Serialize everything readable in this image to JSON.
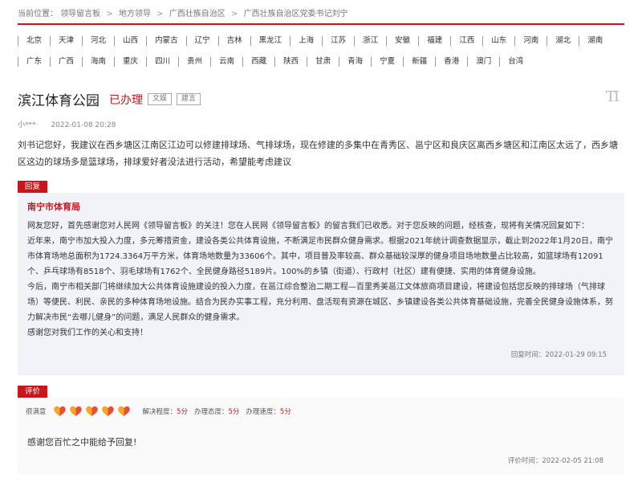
{
  "breadcrumb": {
    "prefix": "当前位置：",
    "items": [
      "领导留言板",
      "地方领导",
      "广西壮族自治区",
      "广西壮族自治区党委书记刘宁"
    ]
  },
  "regions": {
    "row1": [
      "北京",
      "天津",
      "河北",
      "山西",
      "内蒙古",
      "辽宁",
      "吉林",
      "黑龙江",
      "上海",
      "江苏",
      "浙江",
      "安徽",
      "福建",
      "江西",
      "山东",
      "河南",
      "湖北",
      "湖南"
    ],
    "row2": [
      "广东",
      "广西",
      "海南",
      "重庆",
      "四川",
      "贵州",
      "云南",
      "西藏",
      "陕西",
      "甘肃",
      "青海",
      "宁夏",
      "新疆",
      "香港",
      "澳门",
      "台湾"
    ]
  },
  "message": {
    "title": "滨江体育公园",
    "status": "已办理",
    "tags": [
      "文娱",
      "建言"
    ],
    "author": "小***",
    "time": "2022-01-08 20:28",
    "content": "刘书记您好，我建议在西乡塘区江南区江边可以修建排球场、气排球场，现在修建的多集中在青秀区、邕宁区和良庆区离西乡塘区和江南区太远了，西乡塘区这边的球场多是篮球场，排球爱好者没法进行活动，希望能考虑建议"
  },
  "reply": {
    "badge": "回复",
    "org": "南宁市体育局",
    "paragraphs": [
      "网友您好，首先感谢您对人民网《领导留言板》的关注！您在人民网《领导留言板》的留言我们已收悉。对于您反映的问题，经核查，现将有关情况回复如下：",
      "近年来，南宁市加大投入力度，多元筹措资金，建设各类公共体育设施，不断满足市民群众健身需求。根据2021年统计调查数据显示，截止到2022年1月20日，南宁市体育场地总面积为1724.3364万平方米，体育场地数量为33606个。其中，项目普及率较高、群众基础较深厚的健身项目场地数量占比较高，如篮球场有12091个、乒乓球场有8518个、羽毛球场有1762个、全民健身路径5189片。100%的乡镇（街道）、行政村（社区）建有便捷、实用的体育健身设施。",
      "今后，南宁市相关部门将继续加大公共体育设施建设的投入力度，在邕江综合整治二期工程—百里秀美邕江文体旅商项目建设，将建设包括您反映的排球场（气排球场）等便民、利民、亲民的多种体育场地设施。结合为民办实事工程，充分利用、盘活现有资源在城区、乡镇建设各类公共体育基础设施，完善全民健身设施体系，努力解决市民“去哪儿健身”的问题，满足人民群众的健身需求。",
      "感谢您对我们工作的关心和支持！"
    ],
    "time_label": "回复时间：",
    "time": "2022-01-29 09:15"
  },
  "rating": {
    "badge": "评价",
    "overall_label": "很满意",
    "hearts": 5,
    "heart_color": "#e94b3c",
    "details": [
      {
        "label": "解决程度：",
        "value": "5分"
      },
      {
        "label": "办理态度：",
        "value": "5分"
      },
      {
        "label": "办理速度：",
        "value": "5分"
      }
    ],
    "comment": "感谢您百忙之中能给予回复!",
    "time_label": "评价时间：",
    "time": "2022-02-05 21:08"
  }
}
